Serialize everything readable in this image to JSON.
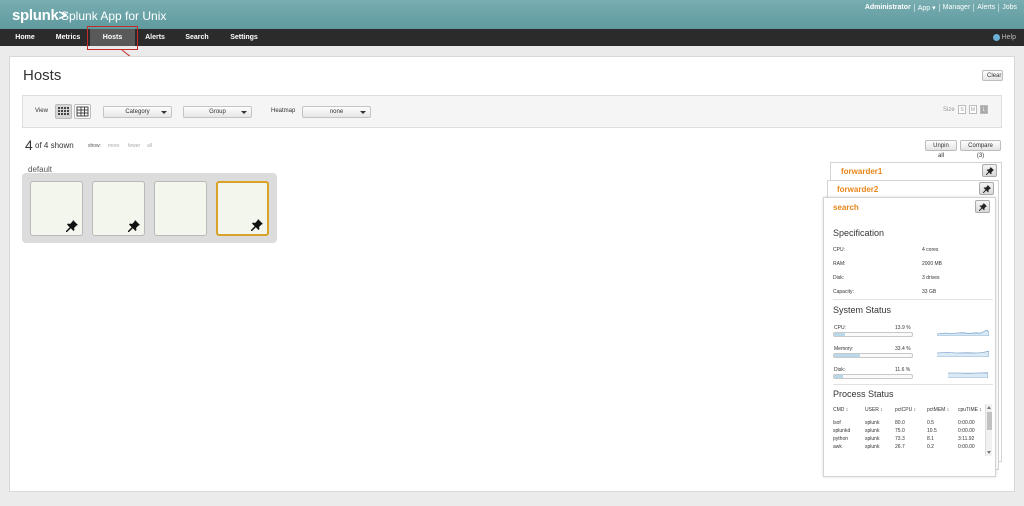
{
  "app": {
    "logo": "splunk>",
    "title": "Splunk App for Unix",
    "user_nav": [
      "Administrator",
      "App ▾",
      "Manager",
      "Alerts",
      "Jobs"
    ]
  },
  "nav": {
    "items": [
      "Home",
      "Metrics",
      "Hosts",
      "Alerts",
      "Search",
      "Settings"
    ],
    "active": "Hosts",
    "help": "Help"
  },
  "page": {
    "title": "Hosts",
    "clear_label": "Clear"
  },
  "toolbar": {
    "view_label": "View",
    "category_label": "Category",
    "group_label": "Group",
    "heatmap_label": "Heatmap",
    "heatmap_value": "none",
    "size_label": "Size",
    "sizes": [
      "S",
      "M",
      "L"
    ],
    "size_selected": "L"
  },
  "summary": {
    "count": "4",
    "of_text": "of 4 shown",
    "show_label": "show:",
    "show_options": [
      "more",
      "fewer",
      "all"
    ],
    "unpin_all": "Unpin all",
    "compare": "Compare (3)"
  },
  "group": {
    "name": "default",
    "tiles": [
      {
        "pinned": true,
        "selected": false
      },
      {
        "pinned": true,
        "selected": false
      },
      {
        "pinned": false,
        "selected": false
      },
      {
        "pinned": true,
        "selected": true
      }
    ]
  },
  "cards": {
    "stack": [
      "forwarder1",
      "forwarder2"
    ],
    "active_host": "search",
    "specification_title": "Specification",
    "spec": [
      {
        "key": "CPU:",
        "value": "4 cores"
      },
      {
        "key": "RAM:",
        "value": "2000 MB"
      },
      {
        "key": "Disk:",
        "value": "3 drives"
      },
      {
        "key": "Capacity:",
        "value": "33 GB"
      }
    ],
    "system_status_title": "System Status",
    "status": [
      {
        "label": "CPU:",
        "value": "13.9 %",
        "fraction": 0.139
      },
      {
        "label": "Memory:",
        "value": "33.4 %",
        "fraction": 0.334
      },
      {
        "label": "Disk:",
        "value": "11.6 %",
        "fraction": 0.116
      }
    ],
    "process_status_title": "Process Status",
    "process_headers": [
      "CMD ↕",
      "USER ↕",
      "pctCPU ↕",
      "pctMEM ↕",
      "cpuTIME ↕"
    ],
    "processes": [
      [
        "lsof",
        "splunk",
        "80.0",
        "0.5",
        "0:00.00"
      ],
      [
        "splunkd",
        "splunk",
        "75.0",
        "10.5",
        "0:00.00"
      ],
      [
        "python",
        "splunk",
        "73.3",
        "8.1",
        "3:11.92"
      ],
      [
        "awk",
        "splunk",
        "26.7",
        "0.2",
        "0:00.00"
      ]
    ]
  },
  "colors": {
    "appbar": "#6ba5aa",
    "navbar": "#2b2b2b",
    "host_title": "#e8861a",
    "selected_tile_border": "#d9a22b",
    "annotation": "#c52b2b"
  }
}
